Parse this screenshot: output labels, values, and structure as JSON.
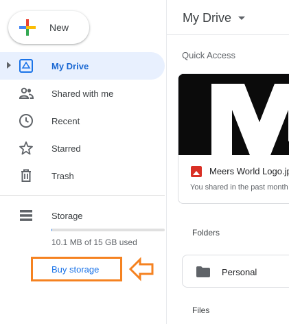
{
  "new_button": {
    "label": "New",
    "icon": "plus-icon"
  },
  "nav": {
    "items": [
      {
        "label": "My Drive",
        "icon": "drive-icon",
        "active": true
      },
      {
        "label": "Shared with me",
        "icon": "people-icon"
      },
      {
        "label": "Recent",
        "icon": "clock-icon"
      },
      {
        "label": "Starred",
        "icon": "star-icon"
      },
      {
        "label": "Trash",
        "icon": "trash-icon"
      }
    ]
  },
  "storage": {
    "label": "Storage",
    "icon": "storage-icon",
    "usage_text": "10.1 MB of 15 GB used",
    "used_fraction": 0.001,
    "buy_label": "Buy storage",
    "highlight_color": "#f58220"
  },
  "main": {
    "title": "My Drive",
    "quick_access_label": "Quick Access",
    "card": {
      "file_name": "Meers World Logo.jpg",
      "subtitle": "You shared in the past month",
      "file_icon": "image-file-icon"
    },
    "folders_label": "Folders",
    "folder": {
      "name": "Personal",
      "icon": "folder-icon"
    },
    "files_label": "Files"
  },
  "colors": {
    "accent": "#1a73e8",
    "active_bg": "#e8f0fe",
    "active_text": "#1967d2"
  }
}
